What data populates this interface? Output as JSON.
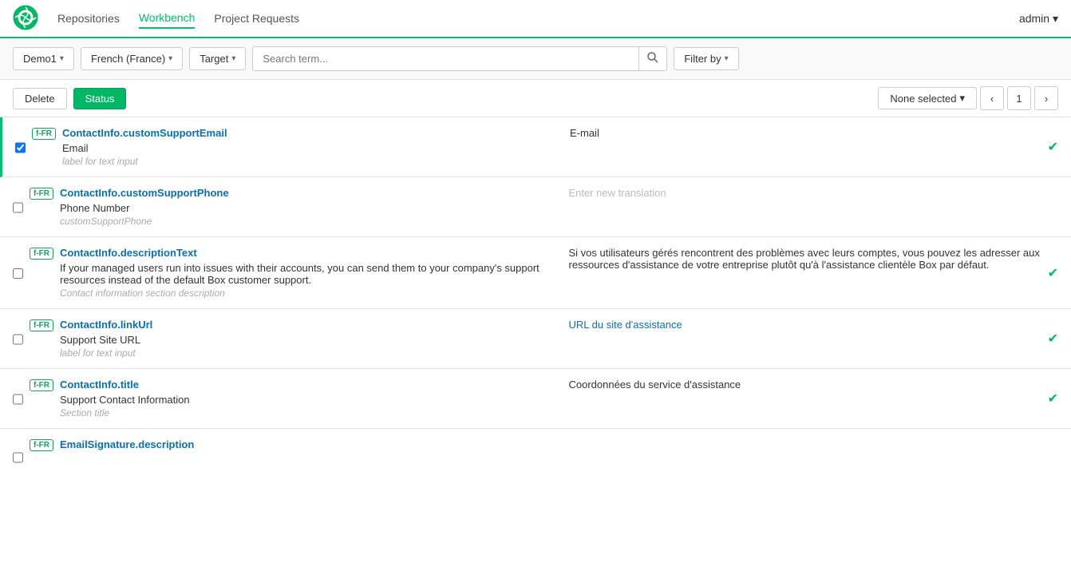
{
  "nav": {
    "logo_alt": "Transifex Logo",
    "links": [
      {
        "label": "Repositories",
        "active": false
      },
      {
        "label": "Workbench",
        "active": true
      },
      {
        "label": "Project Requests",
        "active": false
      }
    ],
    "admin_label": "admin ▾"
  },
  "toolbar": {
    "project_dropdown": "Demo1",
    "language_dropdown": "French (France)",
    "target_dropdown": "Target",
    "search_placeholder": "Search term...",
    "filter_dropdown": "Filter by"
  },
  "action_bar": {
    "delete_label": "Delete",
    "status_label": "Status",
    "none_selected_label": "None selected",
    "page_current": "1",
    "page_prev_label": "‹",
    "page_next_label": "›"
  },
  "rows": [
    {
      "id": "row1",
      "tag": "f-FR",
      "key": "ContactInfo.customSupportEmail",
      "source": "Email",
      "hint": "label for text input",
      "translation": "E-mail",
      "translation_style": "normal",
      "has_check": true,
      "selected": true,
      "input_placeholder": ""
    },
    {
      "id": "row2",
      "tag": "f-FR",
      "key": "ContactInfo.customSupportPhone",
      "source": "Phone Number",
      "hint": "customSupportPhone",
      "translation": "",
      "translation_style": "placeholder",
      "has_check": false,
      "selected": false,
      "input_placeholder": "Enter new translation"
    },
    {
      "id": "row3",
      "tag": "f-FR",
      "key": "ContactInfo.descriptionText",
      "source": "If your managed users run into issues with their accounts, you can send them to your company's support resources instead of the default Box customer support.",
      "hint": "Contact information section description",
      "translation": "Si vos utilisateurs gérés rencontrent des problèmes avec leurs comptes, vous pouvez les adresser aux ressources d'assistance de votre entreprise plutôt qu'à l'assistance clientèle Box par défaut.",
      "translation_style": "normal",
      "has_check": true,
      "selected": false,
      "input_placeholder": ""
    },
    {
      "id": "row4",
      "tag": "f-FR",
      "key": "ContactInfo.linkUrl",
      "source": "Support Site URL",
      "hint": "label for text input",
      "translation": "URL du site d'assistance",
      "translation_style": "link",
      "has_check": true,
      "selected": false,
      "input_placeholder": ""
    },
    {
      "id": "row5",
      "tag": "f-FR",
      "key": "ContactInfo.title",
      "source": "Support Contact Information",
      "hint": "Section title",
      "translation": "Coordonnées du service d'assistance",
      "translation_style": "normal",
      "has_check": true,
      "selected": false,
      "input_placeholder": ""
    },
    {
      "id": "row6",
      "tag": "f-FR",
      "key": "EmailSignature.description",
      "source": "",
      "hint": "",
      "translation": "",
      "translation_style": "normal",
      "has_check": false,
      "selected": false,
      "input_placeholder": ""
    }
  ]
}
